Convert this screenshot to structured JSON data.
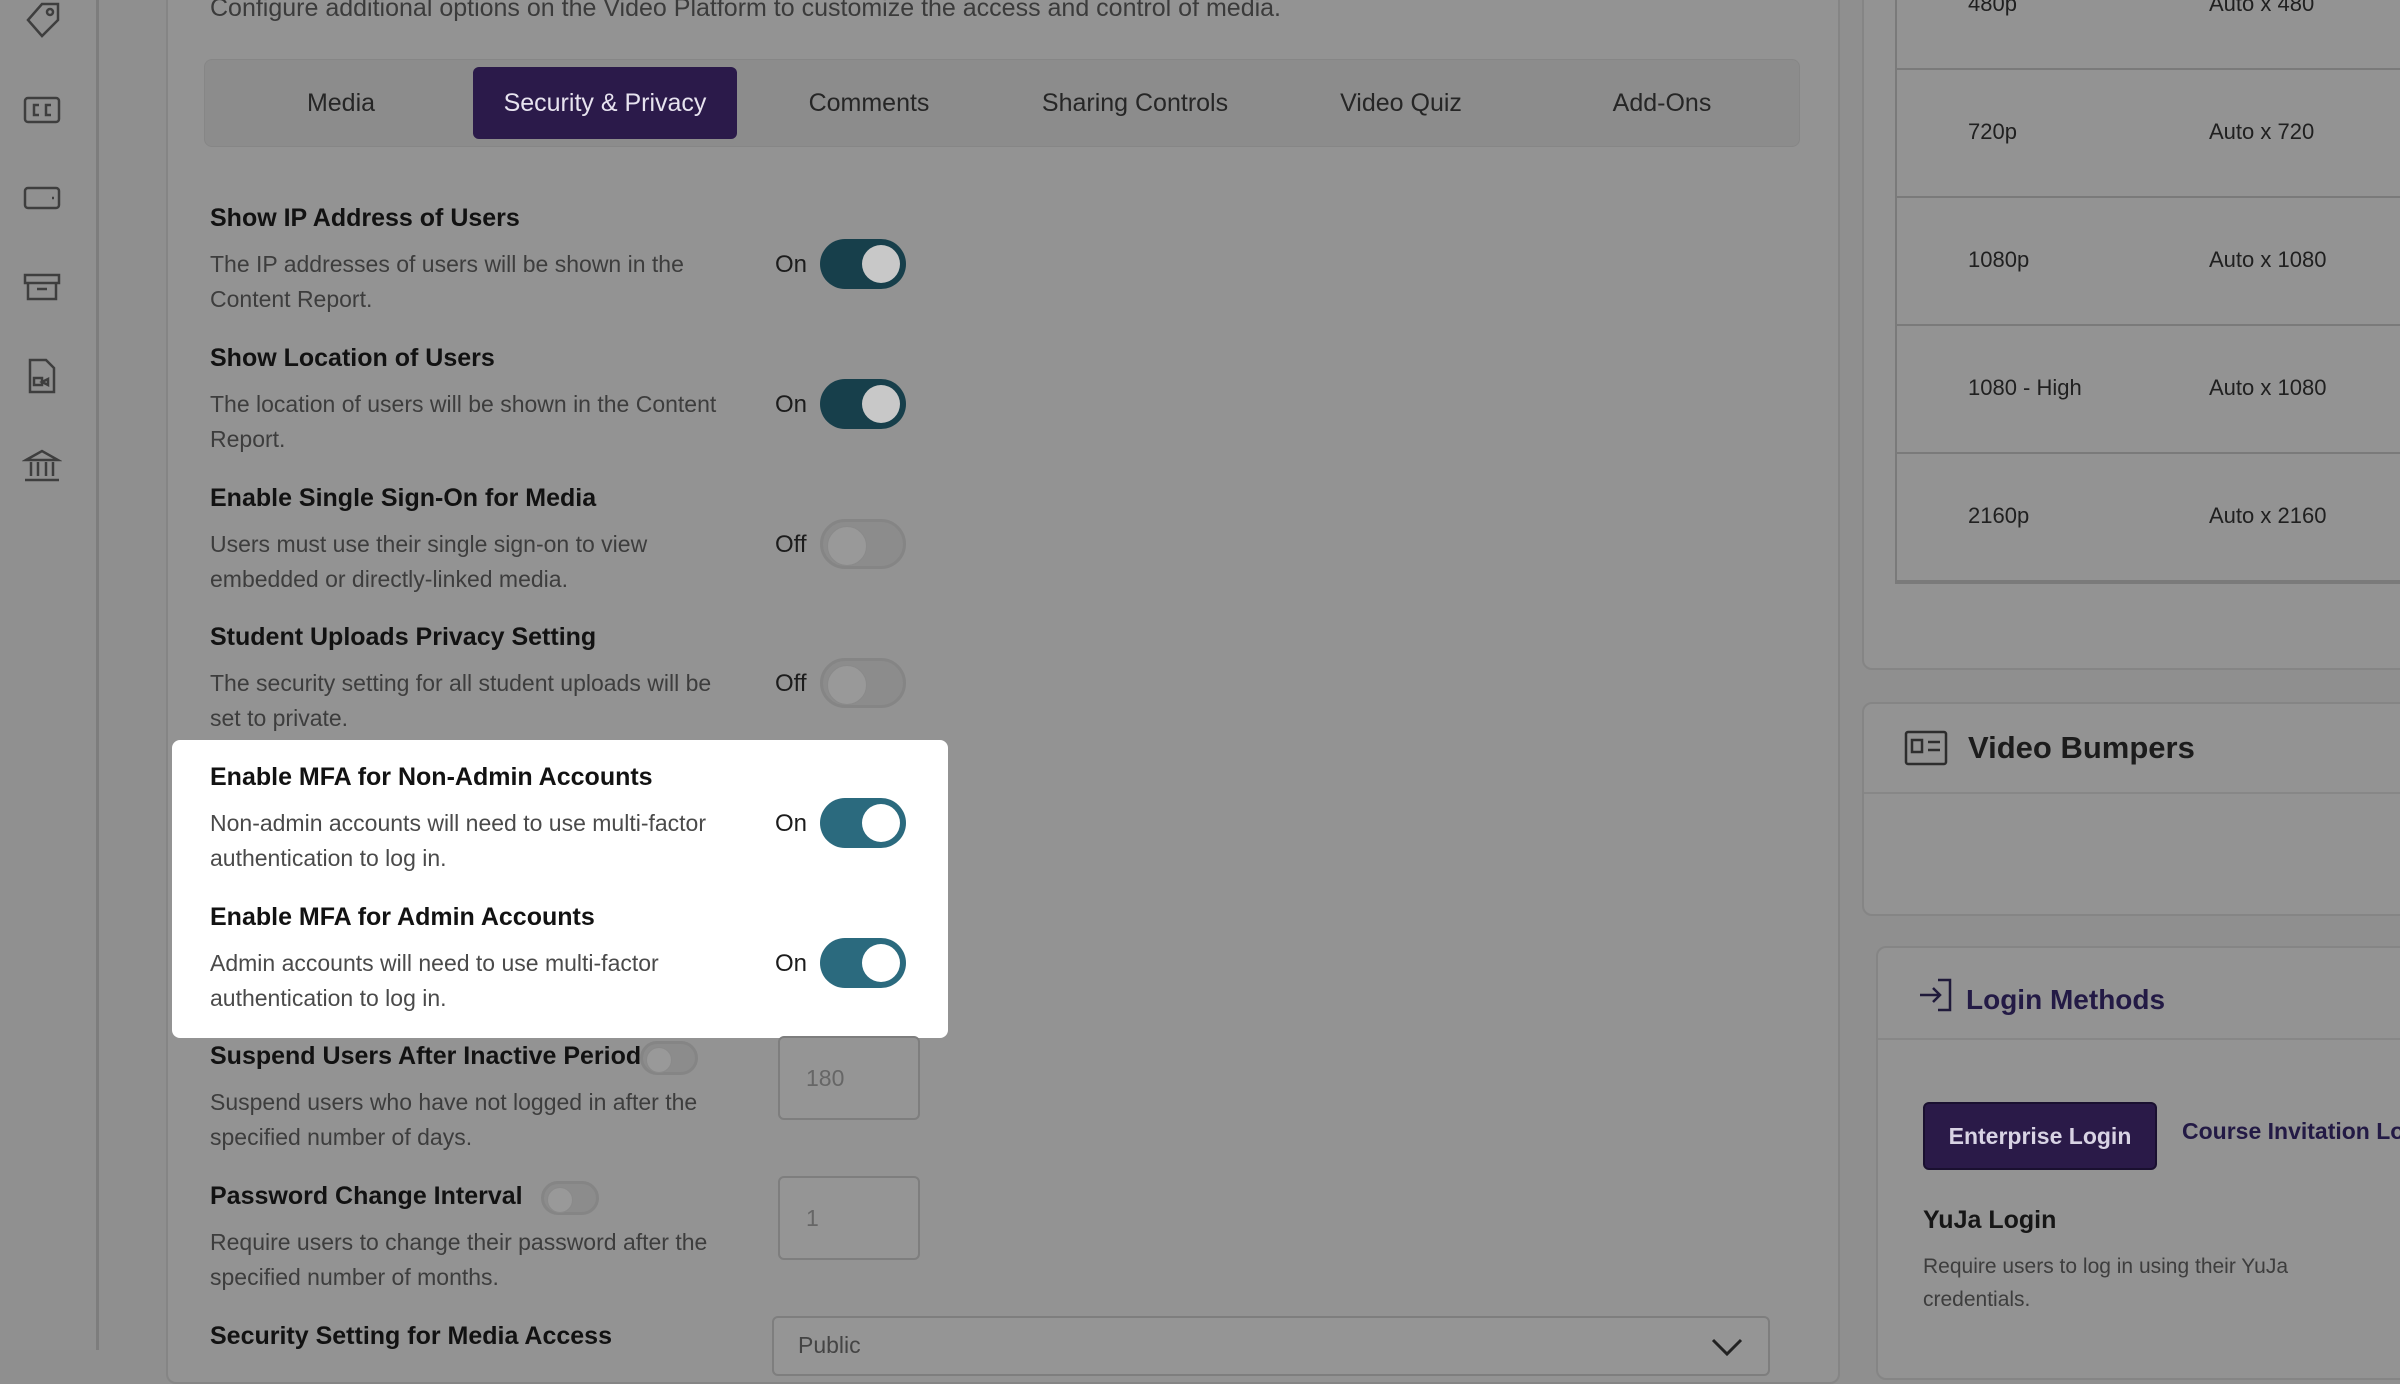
{
  "header": {
    "subtitle": "Configure additional options on the Video Platform to customize the access and control of media."
  },
  "tabs": [
    {
      "label": "Media",
      "active": false
    },
    {
      "label": "Security & Privacy",
      "active": true
    },
    {
      "label": "Comments",
      "active": false
    },
    {
      "label": "Sharing Controls",
      "active": false
    },
    {
      "label": "Video Quiz",
      "active": false
    },
    {
      "label": "Add-Ons",
      "active": false
    }
  ],
  "settings": [
    {
      "title": "Show IP Address of Users",
      "desc": "The IP addresses of users will be shown in the Content Report.",
      "state": "On"
    },
    {
      "title": "Show Location of Users",
      "desc": "The location of users will be shown in the Content Report.",
      "state": "On"
    },
    {
      "title": "Enable Single Sign-On for Media",
      "desc": "Users must use their single sign-on to view embedded or directly-linked media.",
      "state": "Off"
    },
    {
      "title": "Student Uploads Privacy Setting",
      "desc": "The security setting for all student uploads will be set to private.",
      "state": "Off"
    },
    {
      "title": "Enable MFA for Non-Admin Accounts",
      "desc": "Non-admin accounts will need to use multi-factor authentication to log in.",
      "state": "On"
    },
    {
      "title": "Enable MFA for Admin Accounts",
      "desc": "Admin accounts will need to use multi-factor authentication to log in.",
      "state": "On"
    },
    {
      "title": "Suspend Users After Inactive Period",
      "desc": "Suspend users who have not logged in after the specified number of days.",
      "value": "180"
    },
    {
      "title": "Password Change Interval",
      "desc": "Require users to change their password after the specified number of months.",
      "value": "1"
    },
    {
      "title": "Security Setting for Media Access",
      "value": "Public"
    }
  ],
  "resolutions": [
    {
      "name": "480p",
      "size": "Auto x 480"
    },
    {
      "name": "720p",
      "size": "Auto x 720"
    },
    {
      "name": "1080p",
      "size": "Auto x 1080"
    },
    {
      "name": "1080 - High",
      "size": "Auto x 1080"
    },
    {
      "name": "2160p",
      "size": "Auto x 2160"
    }
  ],
  "bumpers": {
    "title": "Video Bumpers"
  },
  "login": {
    "title": "Login Methods",
    "tab_enterprise": "Enterprise Login",
    "tab_course": "Course Invitation Lo",
    "yuja_title": "YuJa Login",
    "yuja_desc": "Require users to log in using their YuJa credentials."
  },
  "icons": [
    "tag-icon",
    "closed-caption-icon",
    "tablet-icon",
    "archive-icon",
    "document-icon",
    "institution-icon"
  ],
  "colors": {
    "accent": "#2b1a4a",
    "toggle_on": "#2b6a7e",
    "highlight": "#ffffff"
  }
}
